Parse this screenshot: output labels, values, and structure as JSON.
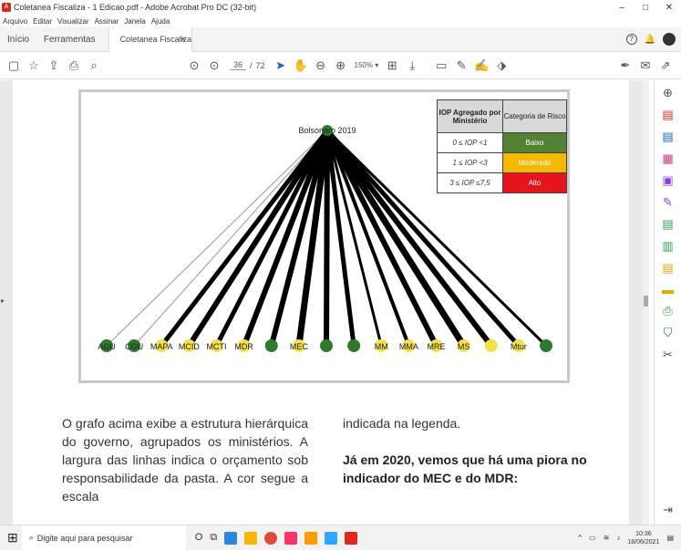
{
  "window": {
    "title": "Coletanea Fiscaliza - 1 Edicao.pdf - Adobe Acrobat Pro DC (32-bit)",
    "minimize": "–",
    "maximize": "□",
    "close": "✕"
  },
  "menu": [
    "Arquivo",
    "Editar",
    "Visualizar",
    "Assinar",
    "Janela",
    "Ajuda"
  ],
  "tabs": {
    "home": "Início",
    "tools": "Ferramentas",
    "doc": "Coletanea Fiscaliza ...",
    "close": "×",
    "help": "?"
  },
  "toolbar": {
    "page_current": "36",
    "page_sep": "/",
    "page_total": "72",
    "zoom": "150%"
  },
  "figure": {
    "root_label": "Bolsonaro 2019",
    "legend": {
      "header_iop": "IOP Agregado por Ministério",
      "header_cat": "Categoria de Risco",
      "rows": [
        {
          "range": "0 ≤ IOP <1",
          "category": "Baixo",
          "color": "#548235"
        },
        {
          "range": "1 ≤ IOP <3",
          "category": "Moderado",
          "color": "#f5b800"
        },
        {
          "range": "3 ≤ IOP ≤7,5",
          "category": "Alto",
          "color": "#e8141c"
        }
      ]
    },
    "nodes": [
      {
        "label": "AGU",
        "color": "green",
        "weight": 1
      },
      {
        "label": "CGU",
        "color": "green",
        "weight": 1
      },
      {
        "label": "MAPA",
        "color": "yellow",
        "weight": 5
      },
      {
        "label": "MCID",
        "color": "yellow",
        "weight": 6
      },
      {
        "label": "MCTI",
        "color": "yellow",
        "weight": 5
      },
      {
        "label": "MDR",
        "color": "yellow",
        "weight": 6
      },
      {
        "label": "",
        "color": "green",
        "weight": 6
      },
      {
        "label": "MEC",
        "color": "yellow",
        "weight": 7
      },
      {
        "label": "",
        "color": "green",
        "weight": 6
      },
      {
        "label": "",
        "color": "green",
        "weight": 5
      },
      {
        "label": "MM",
        "color": "yellow",
        "weight": 3
      },
      {
        "label": "MMA",
        "color": "yellow",
        "weight": 4
      },
      {
        "label": "MRE",
        "color": "yellow",
        "weight": 6
      },
      {
        "label": "MS",
        "color": "yellow",
        "weight": 7
      },
      {
        "label": "",
        "color": "yellow",
        "weight": 6
      },
      {
        "label": "Mtur",
        "color": "yellow",
        "weight": 5
      },
      {
        "label": "",
        "color": "green",
        "weight": 3
      }
    ]
  },
  "body": {
    "left_paragraph": "O grafo acima exibe a estrutura hierárquica do governo, agrupados os ministérios. A largura das linhas indica o orçamento sob responsabilidade da pasta. A cor segue a escala",
    "right_line1": "indicada na legenda.",
    "right_bold": "Já em 2020, vemos que há uma piora no indicador do MEC e do MDR:"
  },
  "taskbar": {
    "search_placeholder": "Digite aqui para pesquisar",
    "time": "10:36",
    "date": "18/06/2021"
  }
}
